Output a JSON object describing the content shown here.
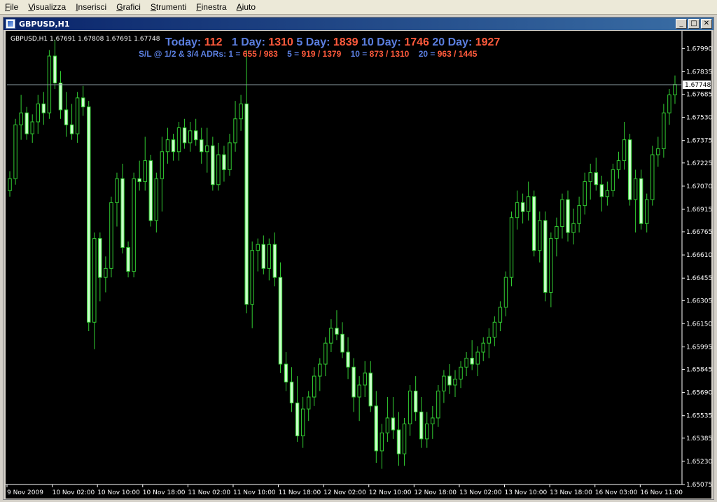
{
  "menu": {
    "items": [
      {
        "key": "F",
        "rest": "ile"
      },
      {
        "key": "V",
        "rest": "isualizza"
      },
      {
        "key": "I",
        "rest": "nserisci"
      },
      {
        "key": "G",
        "rest": "rafici"
      },
      {
        "key": "S",
        "rest": "trumenti"
      },
      {
        "key": "F",
        "rest": "inestra"
      },
      {
        "key": "A",
        "rest": "iuto"
      }
    ]
  },
  "window": {
    "title": "GBPUSD,H1",
    "min_label": "_",
    "max_label": "□",
    "close_label": "✕"
  },
  "chart_header": {
    "symbol_line": "GBPUSD,H1  1.67691 1.67808 1.67691 1.67748"
  },
  "stats": {
    "today_label": "Today:",
    "today_value": "112",
    "d1_label": "1 Day:",
    "d1_value": "1310",
    "d5_label": "5 Day:",
    "d5_value": "1839",
    "d10_label": "10 Day:",
    "d10_value": "1746",
    "d20_label": "20 Day:",
    "d20_value": "1927",
    "sl_label": "S/L @ 1/2 & 3/4 ADRs:",
    "sl1_label": "1 =",
    "sl1_value": "655 / 983",
    "sl5_label": "5 =",
    "sl5_value": "919 / 1379",
    "sl10_label": "10 =",
    "sl10_value": "873 / 1310",
    "sl20_label": "20 =",
    "sl20_value": "963 / 1445"
  },
  "colors": {
    "background": "#000000",
    "candle_up": "#000000",
    "candle_down": "#c8ffc8",
    "wick": "#32cd32",
    "axis_text": "#ffffff",
    "price_line": "#8a9aa0",
    "label_blue": "#5b7fe0",
    "value_red": "#ff5a3c"
  },
  "chart_data": {
    "type": "candlestick",
    "symbol": "GBPUSD",
    "timeframe": "H1",
    "current_price": 1.67748,
    "y_ticks": [
      "1.67990",
      "1.67835",
      "1.67685",
      "1.67530",
      "1.67375",
      "1.67225",
      "1.67070",
      "1.66915",
      "1.66765",
      "1.66610",
      "1.66455",
      "1.66305",
      "1.66150",
      "1.65995",
      "1.65845",
      "1.65690",
      "1.65535",
      "1.65385",
      "1.65230",
      "1.65075"
    ],
    "y_range": [
      1.65075,
      1.6809
    ],
    "x_ticks": [
      "9 Nov 2009",
      "10 Nov 02:00",
      "10 Nov 10:00",
      "10 Nov 18:00",
      "11 Nov 02:00",
      "11 Nov 10:00",
      "11 Nov 18:00",
      "12 Nov 02:00",
      "12 Nov 10:00",
      "12 Nov 18:00",
      "13 Nov 02:00",
      "13 Nov 10:00",
      "13 Nov 18:00",
      "16 Nov 03:00",
      "16 Nov 11:00"
    ],
    "candles": [
      [
        1.6704,
        1.6717,
        1.67,
        1.6712
      ],
      [
        1.6712,
        1.6752,
        1.6708,
        1.6748
      ],
      [
        1.6748,
        1.6768,
        1.6738,
        1.6756
      ],
      [
        1.6756,
        1.676,
        1.6738,
        1.6742
      ],
      [
        1.6742,
        1.6755,
        1.6736,
        1.675
      ],
      [
        1.675,
        1.6768,
        1.6742,
        1.6762
      ],
      [
        1.6762,
        1.677,
        1.6748,
        1.6756
      ],
      [
        1.6756,
        1.6798,
        1.6752,
        1.6794
      ],
      [
        1.6794,
        1.6805,
        1.6772,
        1.6776
      ],
      [
        1.6776,
        1.6784,
        1.6752,
        1.6758
      ],
      [
        1.6758,
        1.677,
        1.674,
        1.6748
      ],
      [
        1.6748,
        1.6762,
        1.6738,
        1.6742
      ],
      [
        1.6742,
        1.677,
        1.6736,
        1.6766
      ],
      [
        1.6766,
        1.6774,
        1.6754,
        1.676
      ],
      [
        1.676,
        1.6764,
        1.661,
        1.6616
      ],
      [
        1.6616,
        1.6676,
        1.6598,
        1.6672
      ],
      [
        1.6672,
        1.6676,
        1.663,
        1.6646
      ],
      [
        1.6646,
        1.666,
        1.6636,
        1.6652
      ],
      [
        1.6652,
        1.67,
        1.6646,
        1.6696
      ],
      [
        1.6696,
        1.6716,
        1.668,
        1.6712
      ],
      [
        1.6712,
        1.6722,
        1.6662,
        1.6666
      ],
      [
        1.6666,
        1.667,
        1.6646,
        1.665
      ],
      [
        1.665,
        1.6716,
        1.6646,
        1.6712
      ],
      [
        1.6712,
        1.6724,
        1.6704,
        1.671
      ],
      [
        1.671,
        1.674,
        1.6704,
        1.6724
      ],
      [
        1.6724,
        1.6728,
        1.668,
        1.6684
      ],
      [
        1.6684,
        1.6716,
        1.6676,
        1.6712
      ],
      [
        1.6712,
        1.674,
        1.669,
        1.673
      ],
      [
        1.673,
        1.6746,
        1.6722,
        1.6738
      ],
      [
        1.6738,
        1.6742,
        1.6724,
        1.673
      ],
      [
        1.673,
        1.675,
        1.6724,
        1.6746
      ],
      [
        1.6746,
        1.6752,
        1.6732,
        1.6736
      ],
      [
        1.6736,
        1.675,
        1.673,
        1.6744
      ],
      [
        1.6744,
        1.6752,
        1.6734,
        1.6738
      ],
      [
        1.6738,
        1.6746,
        1.6722,
        1.673
      ],
      [
        1.673,
        1.6746,
        1.6716,
        1.6734
      ],
      [
        1.6734,
        1.674,
        1.6704,
        1.6708
      ],
      [
        1.6708,
        1.6736,
        1.6704,
        1.6728
      ],
      [
        1.6728,
        1.6734,
        1.671,
        1.6718
      ],
      [
        1.6718,
        1.6742,
        1.6714,
        1.6736
      ],
      [
        1.6736,
        1.6764,
        1.673,
        1.6752
      ],
      [
        1.6752,
        1.6768,
        1.6744,
        1.6762
      ],
      [
        1.6762,
        1.6798,
        1.6622,
        1.6628
      ],
      [
        1.6628,
        1.667,
        1.6612,
        1.6664
      ],
      [
        1.6664,
        1.6672,
        1.665,
        1.6668
      ],
      [
        1.6668,
        1.6674,
        1.6648,
        1.6652
      ],
      [
        1.6652,
        1.6672,
        1.6644,
        1.6668
      ],
      [
        1.6668,
        1.6676,
        1.664,
        1.6646
      ],
      [
        1.6646,
        1.6656,
        1.6582,
        1.6588
      ],
      [
        1.6588,
        1.6596,
        1.657,
        1.6576
      ],
      [
        1.6576,
        1.6586,
        1.6556,
        1.6562
      ],
      [
        1.6562,
        1.658,
        1.6536,
        1.654
      ],
      [
        1.654,
        1.6566,
        1.6532,
        1.6558
      ],
      [
        1.6558,
        1.657,
        1.655,
        1.6566
      ],
      [
        1.6566,
        1.6586,
        1.656,
        1.658
      ],
      [
        1.658,
        1.6592,
        1.657,
        1.6588
      ],
      [
        1.6588,
        1.6606,
        1.658,
        1.6602
      ],
      [
        1.6602,
        1.6618,
        1.6596,
        1.6612
      ],
      [
        1.6612,
        1.6624,
        1.6604,
        1.6608
      ],
      [
        1.6608,
        1.6616,
        1.6592,
        1.6596
      ],
      [
        1.6596,
        1.6606,
        1.6578,
        1.6586
      ],
      [
        1.6586,
        1.6592,
        1.6556,
        1.6566
      ],
      [
        1.6566,
        1.658,
        1.655,
        1.6574
      ],
      [
        1.6574,
        1.659,
        1.6566,
        1.6582
      ],
      [
        1.6582,
        1.659,
        1.6556,
        1.656
      ],
      [
        1.656,
        1.657,
        1.6522,
        1.653
      ],
      [
        1.653,
        1.6548,
        1.6518,
        1.6542
      ],
      [
        1.6542,
        1.6566,
        1.6536,
        1.6552
      ],
      [
        1.6552,
        1.6566,
        1.6538,
        1.6544
      ],
      [
        1.6544,
        1.6556,
        1.652,
        1.6528
      ],
      [
        1.6528,
        1.6552,
        1.652,
        1.6548
      ],
      [
        1.6548,
        1.6574,
        1.654,
        1.657
      ],
      [
        1.657,
        1.658,
        1.655,
        1.6556
      ],
      [
        1.6556,
        1.6566,
        1.6532,
        1.6538
      ],
      [
        1.6538,
        1.6556,
        1.6532,
        1.6548
      ],
      [
        1.6548,
        1.656,
        1.6538,
        1.6552
      ],
      [
        1.6552,
        1.6574,
        1.6546,
        1.657
      ],
      [
        1.657,
        1.6584,
        1.6562,
        1.658
      ],
      [
        1.658,
        1.6588,
        1.6568,
        1.6574
      ],
      [
        1.6574,
        1.6584,
        1.6566,
        1.6578
      ],
      [
        1.6578,
        1.659,
        1.6572,
        1.6586
      ],
      [
        1.6586,
        1.6596,
        1.658,
        1.6592
      ],
      [
        1.6592,
        1.6604,
        1.6584,
        1.6588
      ],
      [
        1.6588,
        1.66,
        1.658,
        1.6596
      ],
      [
        1.6596,
        1.6606,
        1.659,
        1.6602
      ],
      [
        1.6602,
        1.6612,
        1.6592,
        1.6606
      ],
      [
        1.6606,
        1.662,
        1.66,
        1.6616
      ],
      [
        1.6616,
        1.663,
        1.661,
        1.6626
      ],
      [
        1.6626,
        1.665,
        1.662,
        1.6646
      ],
      [
        1.6646,
        1.669,
        1.664,
        1.6686
      ],
      [
        1.6686,
        1.6704,
        1.6678,
        1.6696
      ],
      [
        1.6696,
        1.6702,
        1.6682,
        1.669
      ],
      [
        1.669,
        1.671,
        1.6684,
        1.67
      ],
      [
        1.67,
        1.6704,
        1.666,
        1.6664
      ],
      [
        1.6664,
        1.669,
        1.6656,
        1.6684
      ],
      [
        1.6684,
        1.669,
        1.663,
        1.6636
      ],
      [
        1.6636,
        1.6676,
        1.6626,
        1.6672
      ],
      [
        1.6672,
        1.6686,
        1.666,
        1.668
      ],
      [
        1.668,
        1.6702,
        1.6672,
        1.6698
      ],
      [
        1.6698,
        1.6704,
        1.667,
        1.6676
      ],
      [
        1.6676,
        1.6692,
        1.6668,
        1.6682
      ],
      [
        1.6682,
        1.67,
        1.6676,
        1.6694
      ],
      [
        1.6694,
        1.6716,
        1.6688,
        1.671
      ],
      [
        1.671,
        1.6722,
        1.6698,
        1.6716
      ],
      [
        1.6716,
        1.6726,
        1.6704,
        1.6708
      ],
      [
        1.6708,
        1.6714,
        1.669,
        1.67
      ],
      [
        1.67,
        1.671,
        1.6694,
        1.6704
      ],
      [
        1.6704,
        1.6722,
        1.67,
        1.6718
      ],
      [
        1.6718,
        1.673,
        1.6712,
        1.6724
      ],
      [
        1.6724,
        1.675,
        1.6718,
        1.6738
      ],
      [
        1.6738,
        1.6742,
        1.6694,
        1.6698
      ],
      [
        1.6698,
        1.6718,
        1.6676,
        1.6712
      ],
      [
        1.6712,
        1.6718,
        1.6678,
        1.6682
      ],
      [
        1.6682,
        1.6702,
        1.6676,
        1.6698
      ],
      [
        1.6698,
        1.6734,
        1.6694,
        1.6728
      ],
      [
        1.6728,
        1.674,
        1.672,
        1.6732
      ],
      [
        1.6732,
        1.6762,
        1.6726,
        1.6756
      ],
      [
        1.6756,
        1.6772,
        1.6748,
        1.6768
      ],
      [
        1.6768,
        1.6781,
        1.6762,
        1.6775
      ]
    ]
  }
}
